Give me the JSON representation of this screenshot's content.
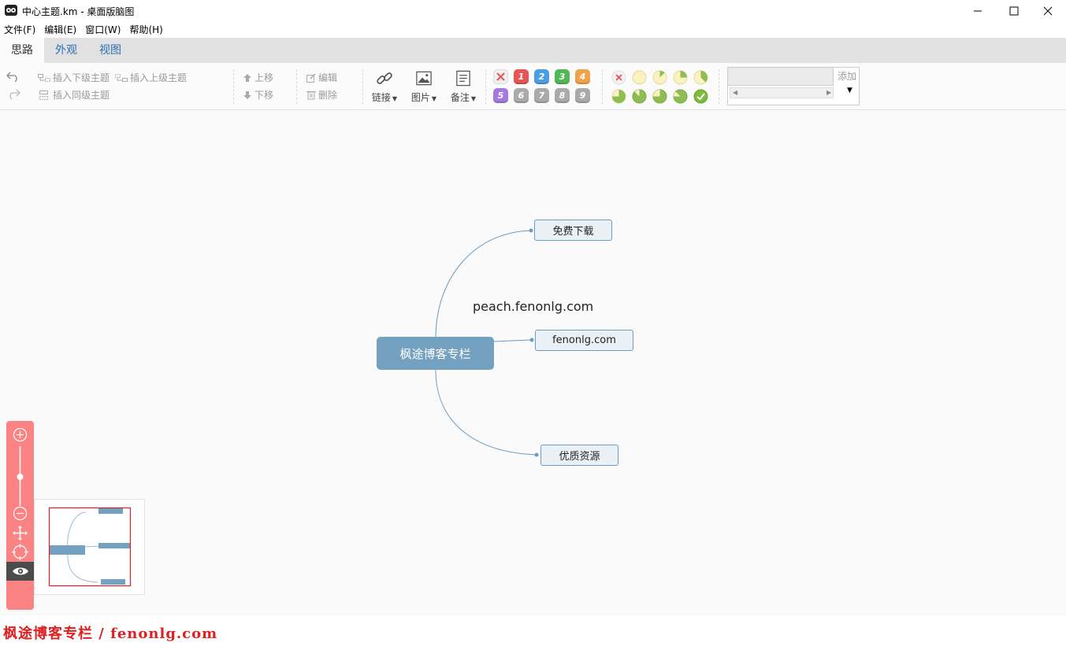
{
  "window": {
    "title": "中心主题.km - 桌面版脑图"
  },
  "menu": [
    "文件(F)",
    "编辑(E)",
    "窗口(W)",
    "帮助(H)"
  ],
  "tabs": [
    "思路",
    "外观",
    "视图"
  ],
  "toolbar": {
    "insert_child": "插入下级主题",
    "insert_parent": "插入上级主题",
    "insert_sibling": "插入同级主题",
    "move_up": "上移",
    "move_down": "下移",
    "edit": "编辑",
    "delete": "删除",
    "link": "链接",
    "image": "图片",
    "note": "备注",
    "priorities": [
      "1",
      "2",
      "3",
      "4",
      "5",
      "6",
      "7",
      "8",
      "9"
    ],
    "resource_add": "添加"
  },
  "colors": {
    "p1": "#e75454",
    "p2": "#4c9de3",
    "p3": "#51b855",
    "p4": "#f0a24a",
    "p5": "#a57ae0",
    "pgray": "#aaaaaa",
    "root": "#73a1bf",
    "zoom_panel": "#fc8383"
  },
  "mindmap": {
    "root": "枫途博客专栏",
    "children": [
      "免费下载",
      "fenonlg.com",
      "优质资源"
    ],
    "overlay_text": "peach.fenonlg.com"
  },
  "footer": {
    "watermark": "枫途博客专栏 / fenonlg.com"
  }
}
